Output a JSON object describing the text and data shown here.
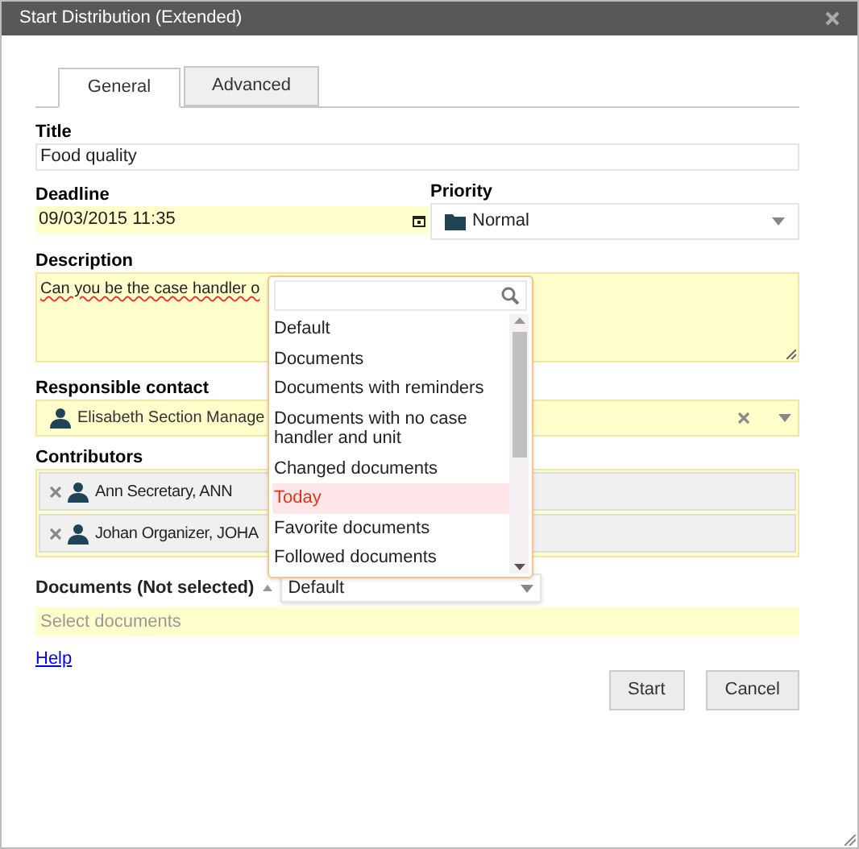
{
  "window": {
    "title": "Start Distribution (Extended)"
  },
  "tabs": [
    {
      "label": "General",
      "selected": true
    },
    {
      "label": "Advanced",
      "selected": false
    }
  ],
  "title_field": {
    "label": "Title",
    "value": "Food quality"
  },
  "deadline": {
    "label": "Deadline",
    "value": "09/03/2015 11:35"
  },
  "priority": {
    "label": "Priority",
    "value": "Normal"
  },
  "description": {
    "label": "Description",
    "value": "Can you be the case handler o"
  },
  "responsible_contact": {
    "label": "Responsible contact",
    "value": "Elisabeth Section Manage"
  },
  "contributors": {
    "label": "Contributors",
    "items": [
      {
        "name": "Ann Secretary, ANN"
      },
      {
        "name": "Johan Organizer, JOHA"
      }
    ]
  },
  "documents": {
    "label": "Documents (Not selected)",
    "filter": "Default",
    "placeholder": "Select documents"
  },
  "filter_dropdown": {
    "items": [
      {
        "label": "Default",
        "selected": false
      },
      {
        "label": "Documents",
        "selected": false
      },
      {
        "label": "Documents with reminders",
        "selected": false
      },
      {
        "label": "Documents with no case handler and unit",
        "selected": false
      },
      {
        "label": "Changed documents",
        "selected": false
      },
      {
        "label": "Today",
        "selected": true
      },
      {
        "label": "Favorite documents",
        "selected": false
      },
      {
        "label": "Followed documents",
        "selected": false
      }
    ]
  },
  "help_link": "Help",
  "buttons": [
    "Start",
    "Cancel"
  ]
}
